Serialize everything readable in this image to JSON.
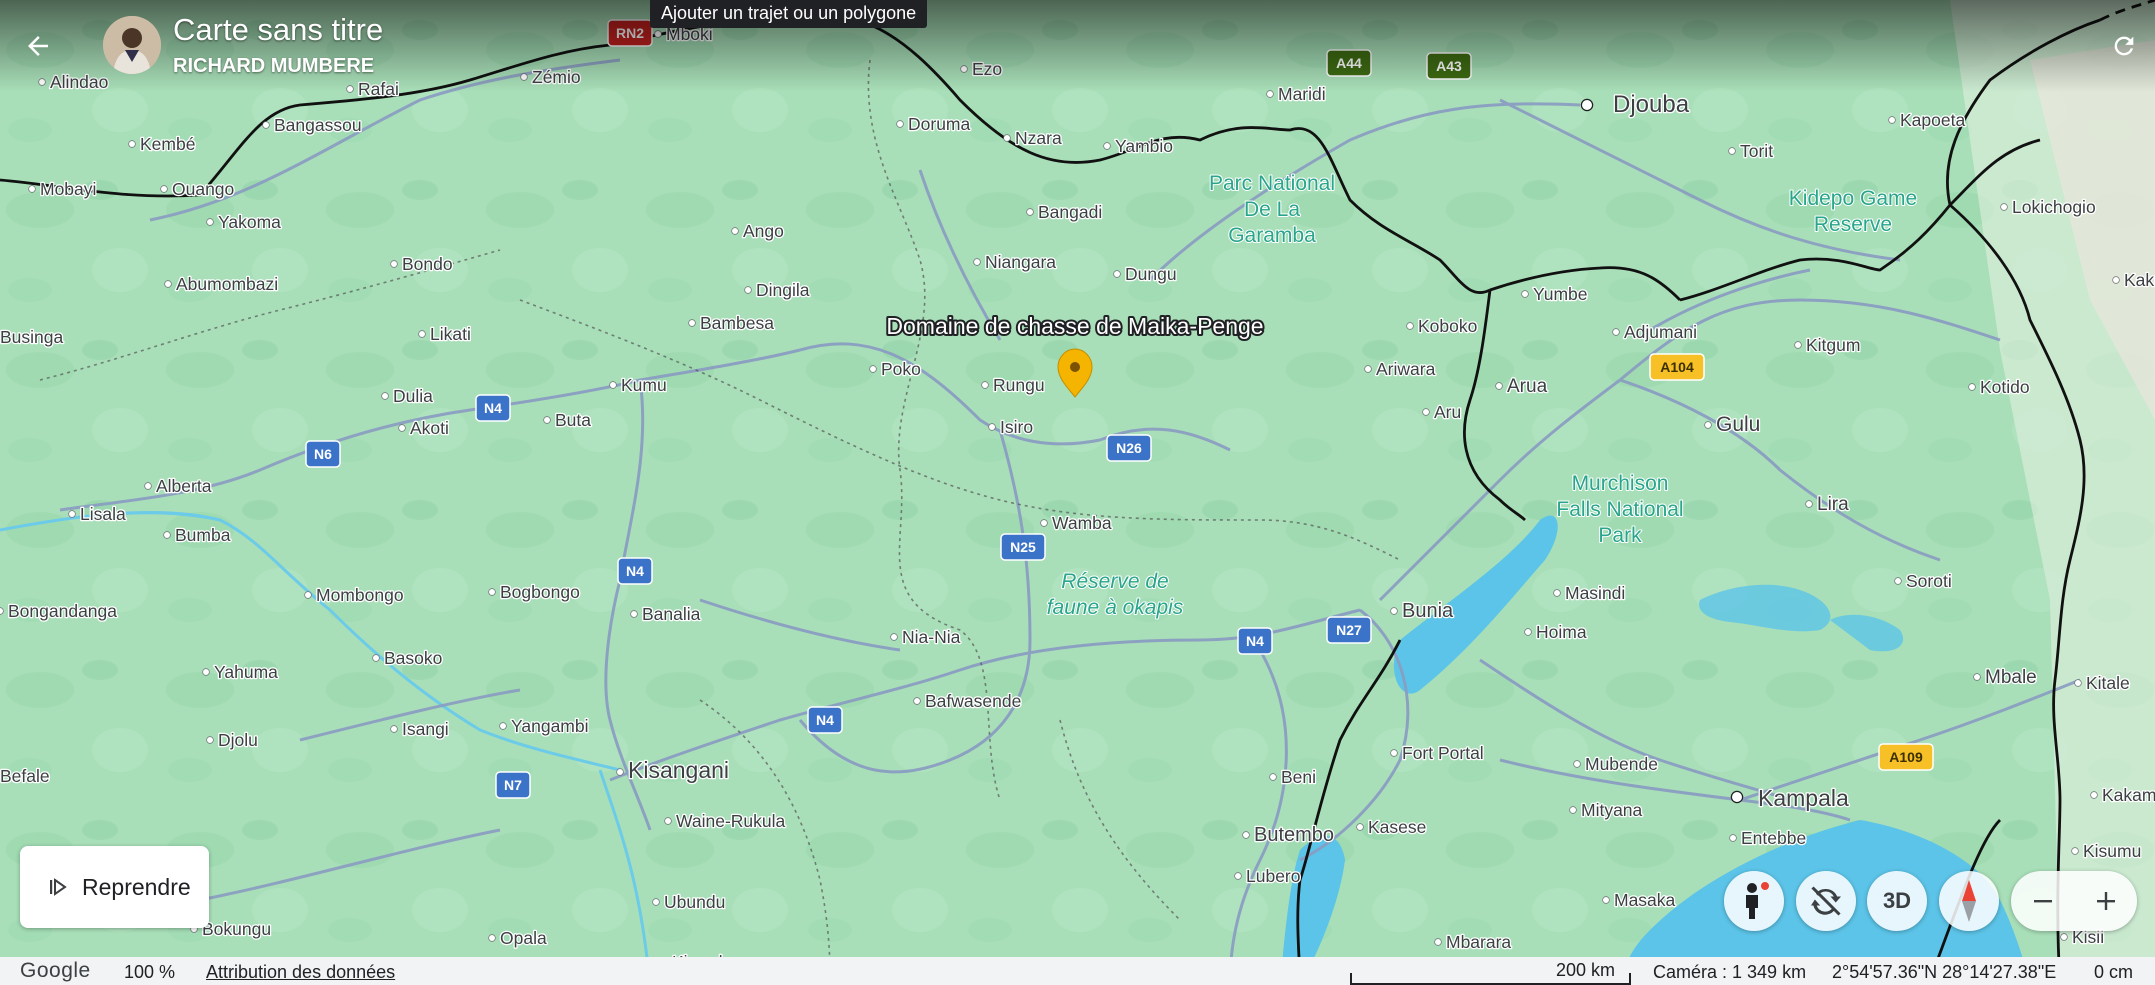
{
  "header": {
    "title": "Carte sans titre",
    "owner": "RICHARD MUMBERE",
    "tooltip": "Ajouter un trajet ou un polygone"
  },
  "places": [
    {
      "name": "Mboki"
    },
    {
      "name": "Ezo"
    },
    {
      "name": "Maridi"
    },
    {
      "name": "Djouba"
    },
    {
      "name": "Alindao"
    },
    {
      "name": "Rafai"
    },
    {
      "name": "Zémio"
    },
    {
      "name": "Kembé"
    },
    {
      "name": "Bangassou"
    },
    {
      "name": "Doruma"
    },
    {
      "name": "Nzara"
    },
    {
      "name": "Yambio"
    },
    {
      "name": "Torit"
    },
    {
      "name": "Kapoeta"
    },
    {
      "name": "Mobayi"
    },
    {
      "name": "Ouango"
    },
    {
      "name": "Yakoma"
    },
    {
      "name": "Bangadi"
    },
    {
      "name": "Lokichogio"
    },
    {
      "name": "Ango"
    },
    {
      "name": "Bondo"
    },
    {
      "name": "Niangara"
    },
    {
      "name": "Dungu"
    },
    {
      "name": "Abumombazi"
    },
    {
      "name": "Dingila"
    },
    {
      "name": "Yumbe"
    },
    {
      "name": "Kakuma"
    },
    {
      "name": "Businga"
    },
    {
      "name": "Likati"
    },
    {
      "name": "Bambesa"
    },
    {
      "name": "Koboko"
    },
    {
      "name": "Adjumani"
    },
    {
      "name": "Kitgum"
    },
    {
      "name": "Poko"
    },
    {
      "name": "Rungu"
    },
    {
      "name": "Ariwara"
    },
    {
      "name": "Kumu"
    },
    {
      "name": "Arua"
    },
    {
      "name": "Kotido"
    },
    {
      "name": "Dulia"
    },
    {
      "name": "Buta"
    },
    {
      "name": "Aru"
    },
    {
      "name": "Akoti"
    },
    {
      "name": "Isiro"
    },
    {
      "name": "Gulu"
    },
    {
      "name": "Alberta"
    },
    {
      "name": "Lira"
    },
    {
      "name": "Lisala"
    },
    {
      "name": "Wamba"
    },
    {
      "name": "Bumba"
    },
    {
      "name": "Mombongo"
    },
    {
      "name": "Bogbongo"
    },
    {
      "name": "Masindi"
    },
    {
      "name": "Soroti"
    },
    {
      "name": "Bongandanga"
    },
    {
      "name": "Banalia"
    },
    {
      "name": "Bunia"
    },
    {
      "name": "Hoima"
    },
    {
      "name": "Nia-Nia"
    },
    {
      "name": "Yahuma"
    },
    {
      "name": "Basoko"
    },
    {
      "name": "Mbale"
    },
    {
      "name": "Kitale"
    },
    {
      "name": "Bafwasende"
    },
    {
      "name": "Isangi"
    },
    {
      "name": "Yangambi"
    },
    {
      "name": "Djolu"
    },
    {
      "name": "Fort Portal"
    },
    {
      "name": "Mubende"
    },
    {
      "name": "Befale"
    },
    {
      "name": "Kisangani"
    },
    {
      "name": "Beni"
    },
    {
      "name": "Mityana"
    },
    {
      "name": "Kampala"
    },
    {
      "name": "Kakamega"
    },
    {
      "name": "Waine-Rukula"
    },
    {
      "name": "Butembo"
    },
    {
      "name": "Kasese"
    },
    {
      "name": "Entebbe"
    },
    {
      "name": "Kisumu"
    },
    {
      "name": "Lubero"
    },
    {
      "name": "Ubundu"
    },
    {
      "name": "Masaka"
    },
    {
      "name": "Bokungu"
    },
    {
      "name": "Opala"
    },
    {
      "name": "Mbarara"
    },
    {
      "name": "Kisii"
    },
    {
      "name": "Kirundu"
    }
  ],
  "parks": [
    {
      "lines": [
        "Parc National",
        "De La",
        "Garamba"
      ]
    },
    {
      "lines": [
        "Kidepo Game",
        "Reserve"
      ]
    },
    {
      "lines": [
        "Murchison",
        "Falls National",
        "Park"
      ]
    },
    {
      "lines": [
        "Réserve de",
        "faune à okapis"
      ]
    }
  ],
  "roads": [
    {
      "label": "RN2",
      "color": "#c5221f"
    },
    {
      "label": "A44",
      "color": "#3d6b12"
    },
    {
      "label": "A43",
      "color": "#3d6b12"
    },
    {
      "label": "A104",
      "color": "#f6c026"
    },
    {
      "label": "N4",
      "color": "#3b73c8"
    },
    {
      "label": "N6",
      "color": "#3b73c8"
    },
    {
      "label": "N26",
      "color": "#3b73c8"
    },
    {
      "label": "N4",
      "color": "#3b73c8"
    },
    {
      "label": "N25",
      "color": "#3b73c8"
    },
    {
      "label": "N4",
      "color": "#3b73c8"
    },
    {
      "label": "N27",
      "color": "#3b73c8"
    },
    {
      "label": "N4",
      "color": "#3b73c8"
    },
    {
      "label": "N7",
      "color": "#3b73c8"
    },
    {
      "label": "A109",
      "color": "#f6c026"
    }
  ],
  "pin": {
    "label": "Domaine de chasse de Maika-Penge",
    "color": "#f4b400"
  },
  "resume_button": {
    "label": "Reprendre"
  },
  "controls": {
    "mode_3d": "3D",
    "street_view_dot_color": "#ea4335"
  },
  "status_bar": {
    "logo": "Google",
    "zoom": "100 %",
    "attribution": "Attribution des données",
    "scale": "200 km",
    "camera": "Caméra : 1 349 km",
    "coordinates": "2°54'57.36\"N 28°14'27.38\"E",
    "elevation": "0 cm"
  },
  "colors": {
    "land": "#a8dfb8",
    "water": "#5cc4e8",
    "road": "#8a9bc2",
    "border": "#111111"
  }
}
